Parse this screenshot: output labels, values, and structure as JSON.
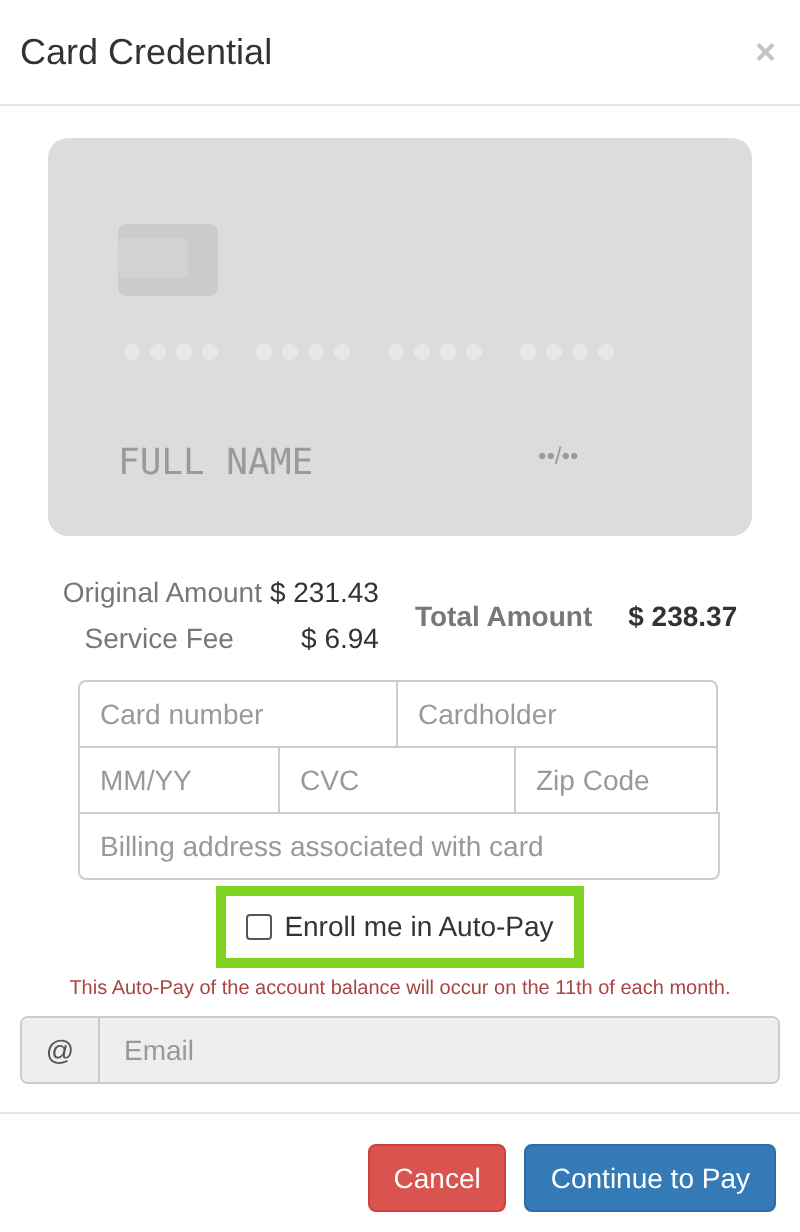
{
  "dialog": {
    "title": "Card Credential",
    "close": "×"
  },
  "card_preview": {
    "name": "FULL NAME",
    "expiry": "••/••"
  },
  "amounts": {
    "original_label": "Original Amount",
    "original": "$ 231.43",
    "fee_label": "Service Fee",
    "fee": "$ 6.94",
    "total_label": "Total Amount",
    "total": "$ 238.37"
  },
  "field_rows": [
    [
      {
        "placeholder": "Card number"
      },
      {
        "placeholder": "Cardholder"
      }
    ],
    [
      {
        "placeholder": "MM/YY"
      },
      {
        "placeholder": "CVC"
      },
      {
        "placeholder": "Zip Code"
      }
    ],
    [
      {
        "placeholder": "Billing address associated with card"
      }
    ]
  ],
  "auto_pay": {
    "label": "Enroll me in Auto-Pay",
    "checked": false,
    "highlighted": true
  },
  "notice": "This Auto-Pay of the account balance will occur on the 11th of each month.",
  "email": {
    "addon": "@",
    "placeholder": "Email",
    "disabled": true
  },
  "buttons": [
    {
      "label": "Cancel",
      "kind": "danger"
    },
    {
      "label": "Continue to Pay",
      "kind": "primary"
    }
  ]
}
